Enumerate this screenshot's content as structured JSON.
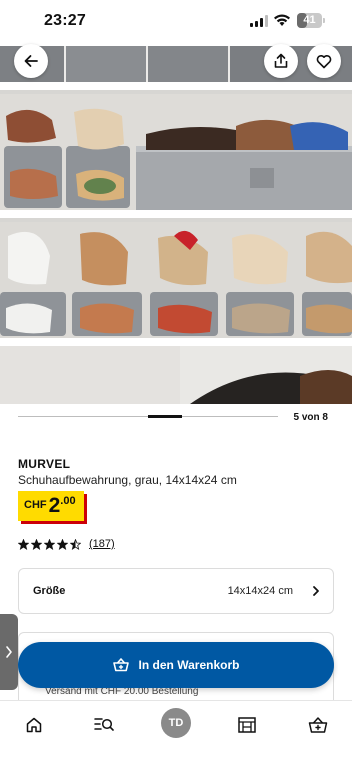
{
  "status_bar": {
    "time": "23:27",
    "battery": "41"
  },
  "gallery": {
    "counter": "5 von 8"
  },
  "product": {
    "name": "MURVEL",
    "description": "Schuhaufbewahrung, grau, 14x14x24 cm",
    "price": {
      "currency": "CHF",
      "main": "2",
      "cents": ".00"
    },
    "rating": {
      "value": 4.5,
      "max": 5,
      "count_text": "(187)"
    }
  },
  "size_selector": {
    "label": "Größe",
    "value": "14x14x24 cm"
  },
  "delivery": {
    "text": "Versand mit CHF 20.00 Bestellung"
  },
  "cart_button": {
    "label": "In den Warenkorb"
  },
  "bottom_nav": {
    "profile_initials": "TD"
  },
  "colors": {
    "accent_blue": "#0058a3",
    "price_yellow": "#ffdb00",
    "price_shadow": "#cc0008"
  }
}
